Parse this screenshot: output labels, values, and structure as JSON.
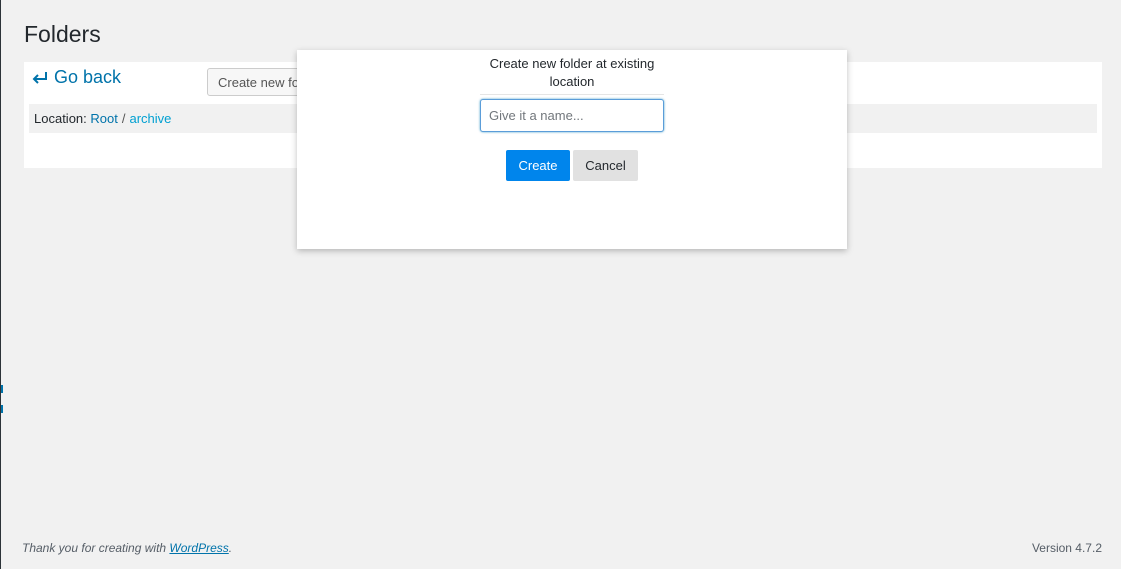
{
  "page": {
    "title": "Folders"
  },
  "toolbar": {
    "go_back_label": "Go back",
    "create_folder_label": "Create new folder"
  },
  "location": {
    "prefix": "Location:",
    "separator": "/",
    "crumbs": [
      "Root",
      "archive"
    ]
  },
  "modal": {
    "title": "Create new folder at existing location",
    "input_placeholder": "Give it a name...",
    "input_value": "",
    "create_label": "Create",
    "cancel_label": "Cancel"
  },
  "footer": {
    "thanks_prefix": "Thank you for creating with",
    "thanks_link": "WordPress",
    "thanks_suffix": ".",
    "version": "Version 4.7.2"
  },
  "colors": {
    "accent": "#0073aa",
    "primary_button": "#0085ec",
    "background": "#f1f1f1"
  },
  "icons": {
    "go_back": "return-arrow-icon"
  }
}
